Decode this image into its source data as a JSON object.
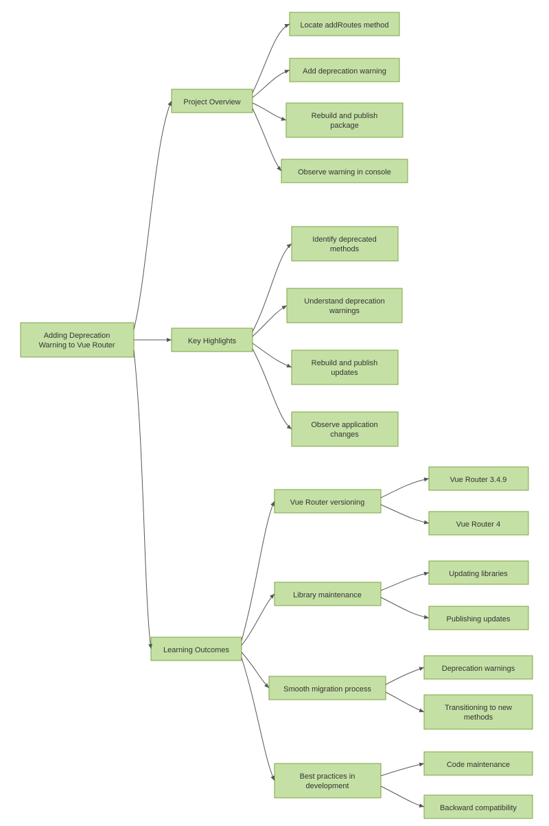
{
  "root": {
    "label": "Adding Deprecation\nWarning to Vue Router"
  },
  "branches": [
    {
      "id": "overview",
      "label": "Project Overview",
      "children": [
        {
          "label": "Locate addRoutes method"
        },
        {
          "label": "Add deprecation warning"
        },
        {
          "label": "Rebuild and publish\npackage"
        },
        {
          "label": "Observe warning in console"
        }
      ]
    },
    {
      "id": "highlights",
      "label": "Key Highlights",
      "children": [
        {
          "label": "Identify deprecated\nmethods"
        },
        {
          "label": "Understand deprecation\nwarnings"
        },
        {
          "label": "Rebuild and publish\nupdates"
        },
        {
          "label": "Observe application\nchanges"
        }
      ]
    },
    {
      "id": "outcomes",
      "label": "Learning Outcomes",
      "children": [
        {
          "label": "Vue Router versioning",
          "children": [
            {
              "label": "Vue Router 3.4.9"
            },
            {
              "label": "Vue Router 4"
            }
          ]
        },
        {
          "label": "Library maintenance",
          "children": [
            {
              "label": "Updating libraries"
            },
            {
              "label": "Publishing updates"
            }
          ]
        },
        {
          "label": "Smooth migration process",
          "children": [
            {
              "label": "Deprecation warnings"
            },
            {
              "label": "Transitioning to new\nmethods"
            }
          ]
        },
        {
          "label": "Best practices in\ndevelopment",
          "children": [
            {
              "label": "Code maintenance"
            },
            {
              "label": "Backward compatibility"
            }
          ]
        }
      ]
    }
  ]
}
